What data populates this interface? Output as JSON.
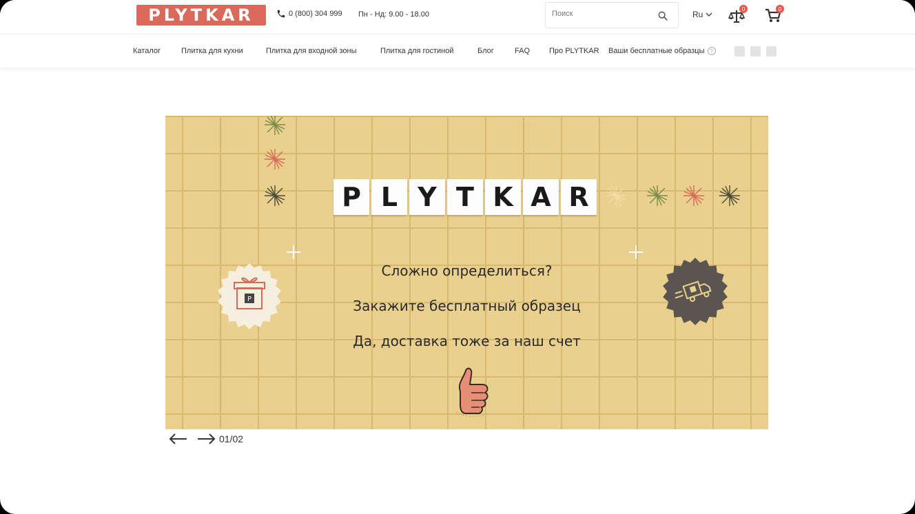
{
  "header": {
    "logo": "PLYTKAR",
    "phone": "0 (800) 304 999",
    "hours": "Пн - Нд: 9.00 - 18.00",
    "search_placeholder": "Поиск",
    "language": "Ru",
    "compare_count": "0",
    "cart_count": "0"
  },
  "nav": {
    "items": [
      "Каталог",
      "Плитка для кухни",
      "Плитка для входной зоны",
      "Плитка для гостиной",
      "Блог",
      "FAQ",
      "Про PLYTKAR",
      "Ваши бесплатные образцы"
    ],
    "help_mark": "?"
  },
  "hero": {
    "wordmark": [
      "P",
      "L",
      "Y",
      "T",
      "K",
      "A",
      "R"
    ],
    "line1": "Сложно определиться?",
    "line2": "Закажите бесплатный образец",
    "line3": "Да, доставка тоже за наш счет",
    "slide_counter": "01/02"
  },
  "colors": {
    "brand": "#d9695a",
    "badge": "#e35b50",
    "banner": "#ead08e",
    "hero_bg": "#ebebf3"
  }
}
